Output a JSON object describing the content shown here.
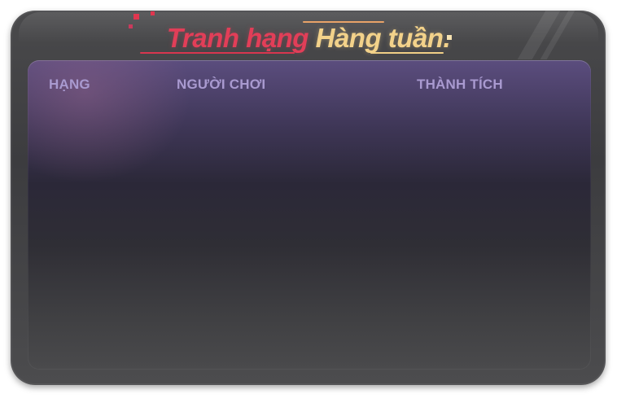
{
  "header": {
    "title_part_1": "Tranh hạng",
    "title_part_2": "Hàng tuần."
  },
  "leaderboard": {
    "columns": {
      "rank": "HẠNG",
      "player": "NGƯỜI CHƠI",
      "score": "THÀNH TÍCH"
    },
    "rows": []
  },
  "colors": {
    "title_red": "#e23e58",
    "title_gold": "#f3d28a",
    "header_text": "#a99ad0",
    "panel_top": "#5b4d7e",
    "frame": "#444446"
  }
}
